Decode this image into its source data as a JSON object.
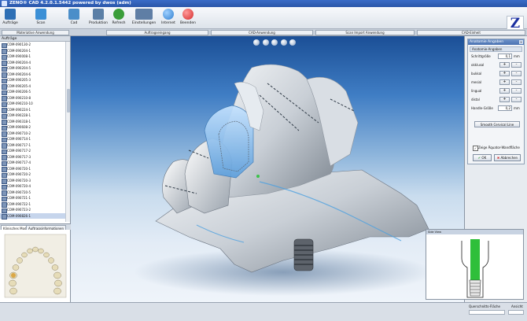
{
  "window": {
    "title": "ZENO® CAD 4.2.0.1.5442 powered by dwos (adm)"
  },
  "brand": {
    "mark": "Z"
  },
  "toolbar": {
    "items": [
      {
        "label": "Aufträge",
        "icon": "orders-icon",
        "color": "#2e6fb5"
      },
      {
        "label": "Scan",
        "icon": "scan-icon",
        "color": "#3b8fd6"
      },
      {
        "label": "Cad",
        "icon": "cad-icon",
        "color": "#4b8ec9"
      },
      {
        "label": "Produktion",
        "icon": "production-icon",
        "color": "#5b7fa6"
      },
      {
        "label": "Refresh",
        "icon": "refresh-icon",
        "color": "#3a9e3a"
      },
      {
        "label": "Einstellungen",
        "icon": "settings-icon",
        "color": "#5f7ea5"
      },
      {
        "label": "Internet",
        "icon": "internet-icon",
        "color": "#2f7fd0"
      },
      {
        "label": "Beenden",
        "icon": "exit-icon",
        "color": "#d42a2a"
      }
    ]
  },
  "tabs": [
    {
      "label": "Materiative Anwendung"
    },
    {
      "label": "Auftragseingang"
    },
    {
      "label": "CAD-Anwendung"
    },
    {
      "label": "Scan Import Anwendung"
    },
    {
      "label": "CAD-Einheit"
    }
  ],
  "left": {
    "header": "Aufträge",
    "orders": [
      "COM-090130-2",
      "COM-090204-1",
      "COM-090008-1",
      "COM-090204-4",
      "COM-090204-5",
      "COM-090204-6",
      "COM-090205-3",
      "COM-090205-4",
      "COM-090206-5",
      "COM-090210-8",
      "COM-090210-10",
      "COM-090224-1",
      "COM-090228-1",
      "COM-090318-1",
      "COM-090608-2",
      "COM-090710-2",
      "COM-090714-1",
      "COM-090717-1",
      "COM-090717-2",
      "COM-090717-3",
      "COM-090717-4",
      "COM-090720-1",
      "COM-090720-2",
      "COM-090720-3",
      "COM-090720-4",
      "COM-090720-5",
      "COM-090721-1",
      "COM-090722-1",
      "COM-090723-2",
      "COM-090826-1"
    ],
    "selected_index": 29
  },
  "bottom_tabs": [
    {
      "label": "Klinisches Modell"
    },
    {
      "label": "Auftragsinformationen"
    }
  ],
  "dialog": {
    "title": "Anatomie Angaben",
    "section": "Anatomie-Angaben",
    "step_label": "Schrittgröße",
    "step_value": "0,1",
    "step_unit": "mm",
    "rows": [
      {
        "label": "okklusal"
      },
      {
        "label": "bukkal"
      },
      {
        "label": "mesial"
      },
      {
        "label": "lingual"
      },
      {
        "label": "distal"
      }
    ],
    "plus_label": "+",
    "minus_label": "-",
    "handle_label": "Handle-Größe",
    "handle_value": "0,2",
    "handle_unit": "mm",
    "smooth_label": "Smooth Cervical Line",
    "checkbox_label": "Zeige Äquator-Wandfläche",
    "ok_label": "OK",
    "cancel_label": "Abbrechen"
  },
  "cross_section": {
    "title": "Side View"
  },
  "status": {
    "field1_label": "Querschnitts-Fläche",
    "field2_label": "Ansicht"
  }
}
